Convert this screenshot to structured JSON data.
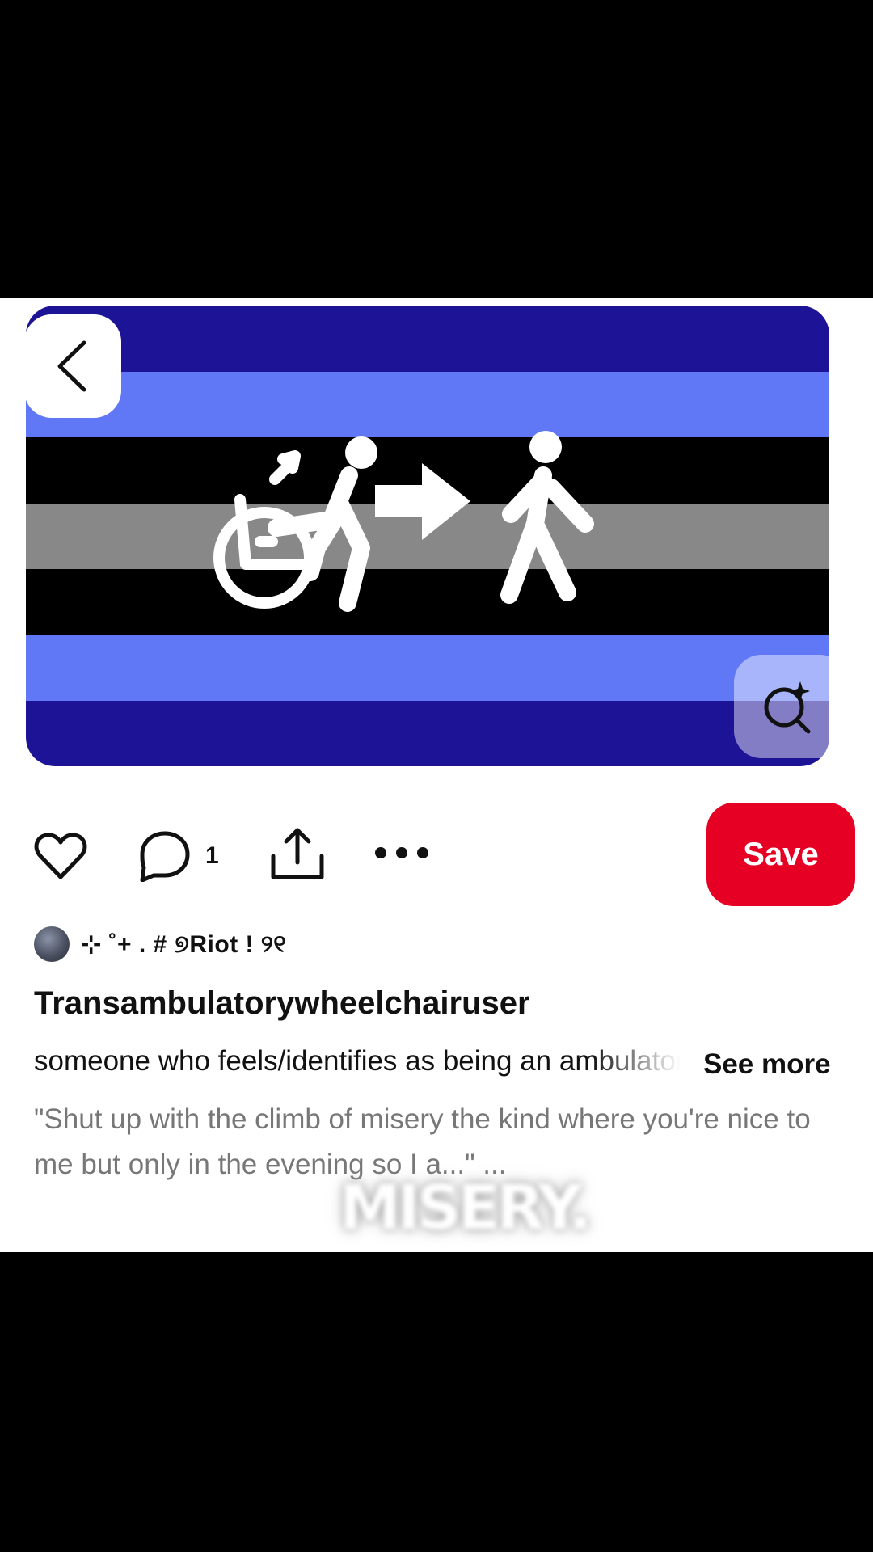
{
  "pin": {
    "colors": {
      "stripe_dark_blue": "#1c1396",
      "stripe_light_blue": "#6178f6",
      "stripe_black": "#000000",
      "stripe_gray": "#888888",
      "save_red": "#e60023"
    },
    "image_icon_names": [
      "wheelchair-figure-icon",
      "arrow-right-icon",
      "walking-figure-icon"
    ]
  },
  "actions": {
    "comment_count": "1",
    "save_label": "Save"
  },
  "author": {
    "name": "⊹ ˚+ . # ୭Riot ! ୨୧"
  },
  "post": {
    "title": "Transambulatorywheelchairuser",
    "description": "someone who feels/identifies as being an ambulatory",
    "see_more": "See more",
    "quote": "\"Shut up with the climb of misery the kind where you're nice to me but only in the evening so I a...\" ..."
  },
  "overlay": {
    "watermark_text": "MISERY."
  }
}
